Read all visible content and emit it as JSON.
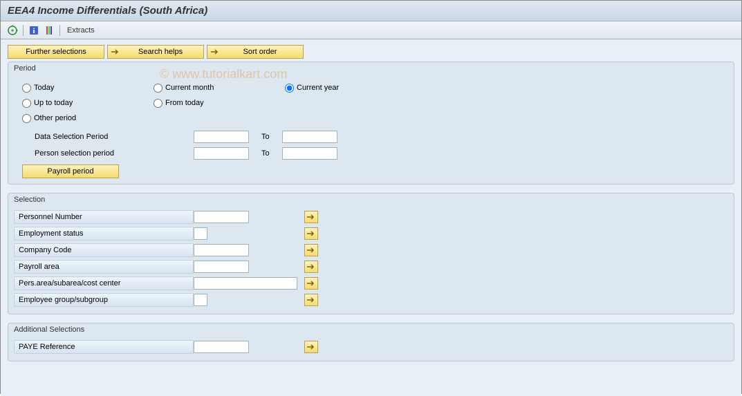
{
  "title": "EEA4 Income Differentials (South Africa)",
  "watermark": "© www.tutorialkart.com",
  "toolbar": {
    "extracts": "Extracts"
  },
  "buttons": {
    "further_selections": "Further selections",
    "search_helps": "Search helps",
    "sort_order": "Sort order",
    "payroll_period": "Payroll period"
  },
  "period": {
    "title": "Period",
    "today": "Today",
    "up_to_today": "Up to today",
    "other_period": "Other period",
    "current_month": "Current month",
    "from_today": "From today",
    "current_year": "Current year",
    "data_sel_period": "Data Selection Period",
    "person_sel_period": "Person selection period",
    "to": "To",
    "selected": "current_year",
    "data_from": "",
    "data_to": "",
    "person_from": "",
    "person_to": ""
  },
  "selection": {
    "title": "Selection",
    "rows": [
      {
        "label": "Personnel Number",
        "value": "",
        "width": "w80",
        "arrow": true
      },
      {
        "label": "Employment status",
        "value": "",
        "width": "w18",
        "arrow": true
      },
      {
        "label": "Company Code",
        "value": "",
        "width": "w80",
        "arrow": true
      },
      {
        "label": "Payroll area",
        "value": "",
        "width": "w80",
        "arrow": true
      },
      {
        "label": "Pers.area/subarea/cost center",
        "value": "",
        "width": "w150",
        "arrow": true
      },
      {
        "label": "Employee group/subgroup",
        "value": "",
        "width": "w18",
        "arrow": true
      }
    ]
  },
  "additional": {
    "title": "Additional Selections",
    "rows": [
      {
        "label": "PAYE Reference",
        "value": "",
        "width": "w80",
        "arrow": true
      }
    ]
  }
}
